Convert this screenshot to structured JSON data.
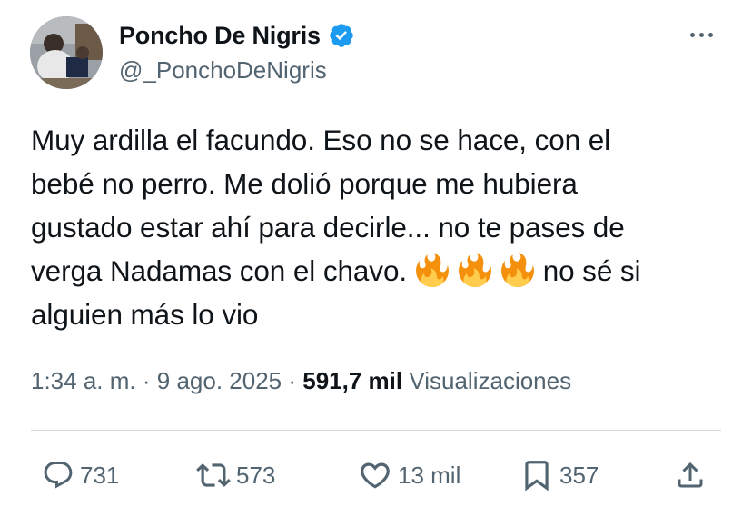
{
  "author": {
    "display_name": "Poncho De Nigris",
    "handle": "@_PonchoDeNigris",
    "verified": true,
    "avatar_icon": "profile-photo"
  },
  "menu": {
    "more_icon": "ellipsis-icon"
  },
  "tweet": {
    "lines": [
      "Muy ardilla el facundo. Eso no se hace, con el",
      "bebé no perro. Me dolió porque me hubiera",
      "gustado estar ahí para decirle... no te pases de",
      "verga Nadamas con el chavo.",
      "no sé si",
      "alguien más lo vio"
    ],
    "emoji": [
      "🔥",
      "🔥",
      "🔥"
    ]
  },
  "meta": {
    "time": "1:34 a. m.",
    "separator": "·",
    "date": "9 ago. 2025",
    "views_count": "591,7 mil",
    "views_label": "Visualizaciones"
  },
  "actions": {
    "replies": "731",
    "reposts": "573",
    "likes": "13 mil",
    "bookmarks": "357"
  },
  "colors": {
    "text": "#0f1419",
    "secondary": "#536471",
    "verified": "#1d9bf0",
    "divider": "#cfd9de"
  }
}
